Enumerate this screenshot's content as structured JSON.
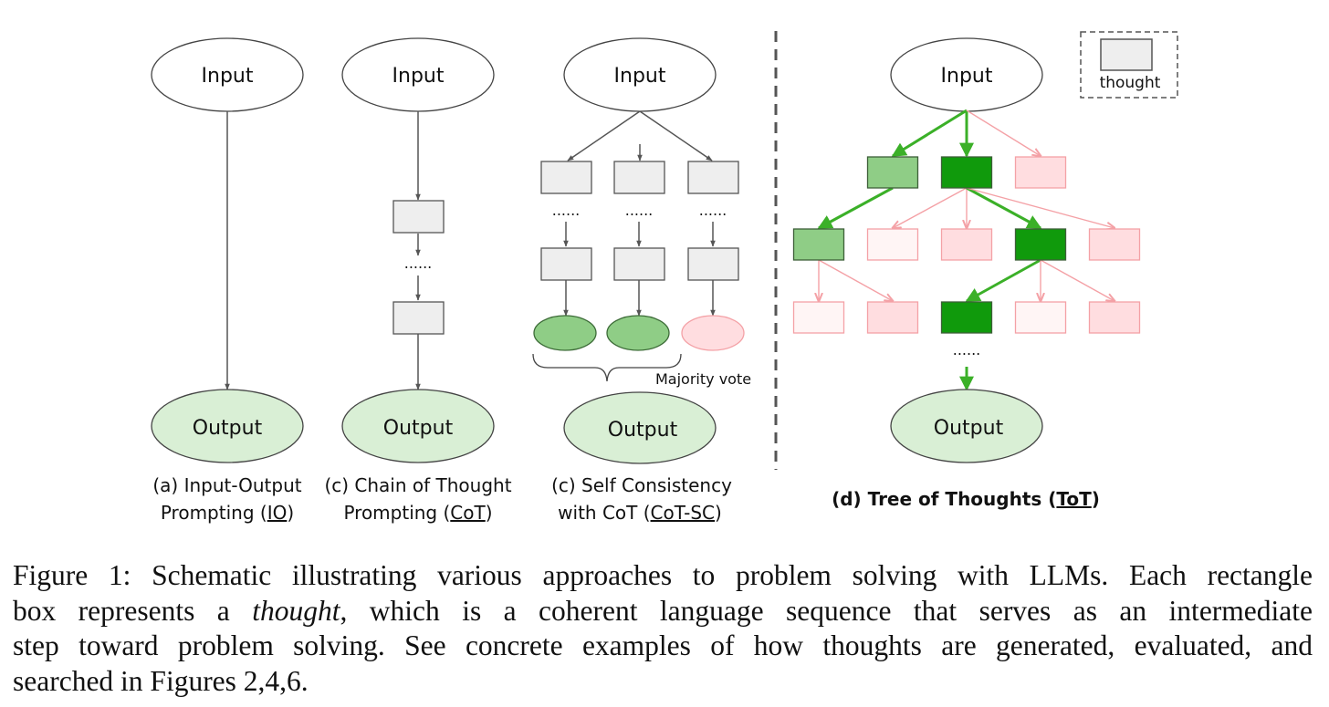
{
  "colors": {
    "stroke_gray": "#555555",
    "ellipse_border": "#444444",
    "thought_fill": "#eeeeee",
    "output_fill": "#d9efd5",
    "green_light": "#8fcd86",
    "green_dark": "#109a0c",
    "green_edge": "#3bb028",
    "pink_fill": "#ffdde0",
    "pink_pale": "#fff5f5",
    "pink_stroke": "#f4a1a6",
    "divider": "#555555"
  },
  "panels": {
    "io": {
      "input_label": "Input",
      "output_label": "Output",
      "caption_line1": "(a) Input-Output",
      "caption_line2_prefix": "Prompting (",
      "caption_abbr": "IO",
      "caption_line2_suffix": ")"
    },
    "cot": {
      "input_label": "Input",
      "output_label": "Output",
      "ellipsis": "......",
      "caption_line1": "(c) Chain of Thought",
      "caption_line2_prefix": "Prompting (",
      "caption_abbr": "CoT",
      "caption_line2_suffix": ")"
    },
    "cot_sc": {
      "input_label": "Input",
      "output_label": "Output",
      "ellipsis": "......",
      "majority_vote_label": "Majority vote",
      "caption_line1": "(c) Self Consistency",
      "caption_line2_prefix": "with CoT (",
      "caption_abbr": "CoT-SC",
      "caption_line2_suffix": ")",
      "answers": [
        "selected",
        "selected",
        "rejected"
      ]
    },
    "tot": {
      "input_label": "Input",
      "output_label": "Output",
      "ellipsis": "......",
      "legend_label": "thought",
      "caption_prefix": "(d) Tree of Thoughts (",
      "caption_abbr": "ToT",
      "caption_suffix": ")",
      "level1": [
        "green-light",
        "green-dark",
        "pink"
      ],
      "level2": [
        "green-light",
        "pink-pale",
        "pink",
        "green-dark",
        "pink"
      ],
      "level3": [
        "pink-pale",
        "pink",
        "green-dark",
        "pink-pale",
        "pink"
      ]
    }
  },
  "figure_caption": {
    "line1": "Figure 1: Schematic illustrating various approaches to problem solving with LLMs. Each rectangle",
    "line2_before": "box represents a ",
    "line2_italic": "thought",
    "line2_after": ", which is a coherent language sequence that serves as an intermediate",
    "line3": "step toward problem solving. See concrete examples of how thoughts are generated, evaluated, and",
    "line4": "searched in Figures 2,4,6."
  }
}
